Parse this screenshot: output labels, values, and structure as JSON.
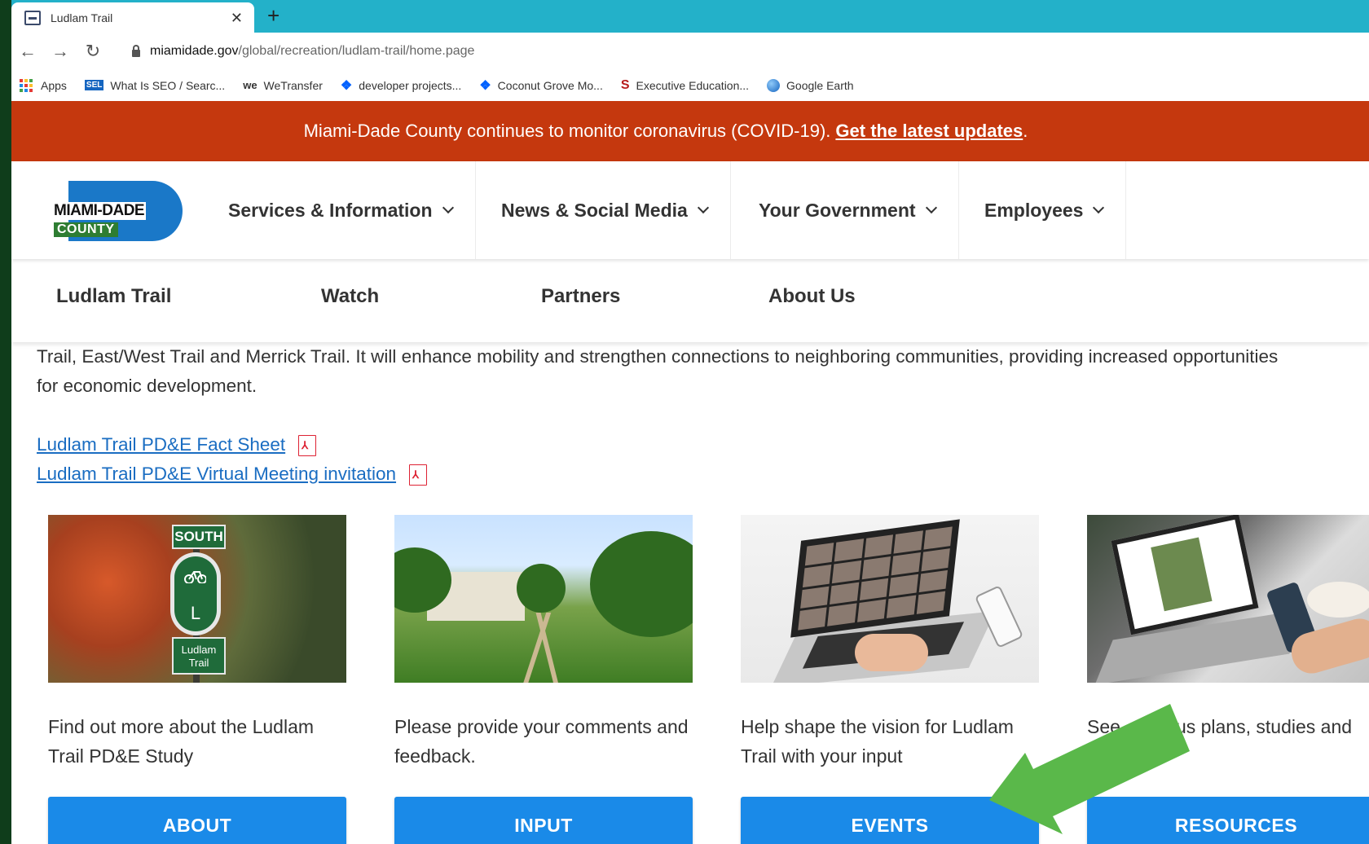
{
  "browser": {
    "tab_title": "Ludlam Trail",
    "url_domain": "miamidade.gov",
    "url_path": "/global/recreation/ludlam-trail/home.page",
    "bookmarks": [
      {
        "label": "Apps",
        "icon": "apps-grid-icon"
      },
      {
        "label": "What Is SEO / Searc...",
        "icon": "sel-icon"
      },
      {
        "label": "WeTransfer",
        "icon": "wetransfer-icon"
      },
      {
        "label": "developer projects...",
        "icon": "dropbox-icon"
      },
      {
        "label": "Coconut Grove Mo...",
        "icon": "dropbox-icon"
      },
      {
        "label": "Executive Education...",
        "icon": "s-logo-icon"
      },
      {
        "label": "Google Earth",
        "icon": "google-earth-icon"
      }
    ]
  },
  "banner": {
    "text": "Miami-Dade County continues to monitor coronavirus (COVID-19).",
    "link": "Get the latest updates",
    "suffix": ".",
    "color": "#c5380e"
  },
  "logo": {
    "main": "MIAMI-DADE",
    "sub": "COUNTY"
  },
  "main_nav": [
    {
      "label": "Services & Information"
    },
    {
      "label": "News & Social Media"
    },
    {
      "label": "Your Government"
    },
    {
      "label": "Employees"
    }
  ],
  "sub_nav": [
    {
      "label": "Ludlam Trail"
    },
    {
      "label": "Watch"
    },
    {
      "label": "Partners"
    },
    {
      "label": "About Us"
    }
  ],
  "intro": {
    "line1": "Trail, East/West Trail and Merrick Trail. It will enhance mobility and strengthen connections to neighboring communities, providing increased opportunities",
    "line2": "for economic development."
  },
  "doc_links": [
    {
      "label": "Ludlam Trail PD&E Fact Sheet ",
      "icon": "pdf-icon"
    },
    {
      "label": "Ludlam Trail PD&E Virtual Meeting invitation",
      "icon": "pdf-icon"
    }
  ],
  "cards": [
    {
      "text": "Find out more about the Ludlam Trail PD&E Study",
      "button": "ABOUT",
      "image": "trail-sign-photo",
      "sign_top": "SOUTH",
      "sign_letter": "L",
      "sign_bottom_1": "Ludlam",
      "sign_bottom_2": "Trail"
    },
    {
      "text": "Please provide your comments and feedback.",
      "button": "INPUT",
      "image": "trail-path-photo"
    },
    {
      "text": "Help shape the vision for Ludlam Trail with your input",
      "button": "EVENTS",
      "image": "laptop-meeting-photo"
    },
    {
      "text_start": "See",
      "text_end": "us plans, studies and",
      "button": "RESOURCES",
      "image": "laptop-phone-photo"
    }
  ],
  "colors": {
    "button_blue": "#1a8ae8",
    "link_blue": "#1a6dc2",
    "tab_strip": "#23b1c9",
    "annotation_arrow": "#5ab84a"
  }
}
